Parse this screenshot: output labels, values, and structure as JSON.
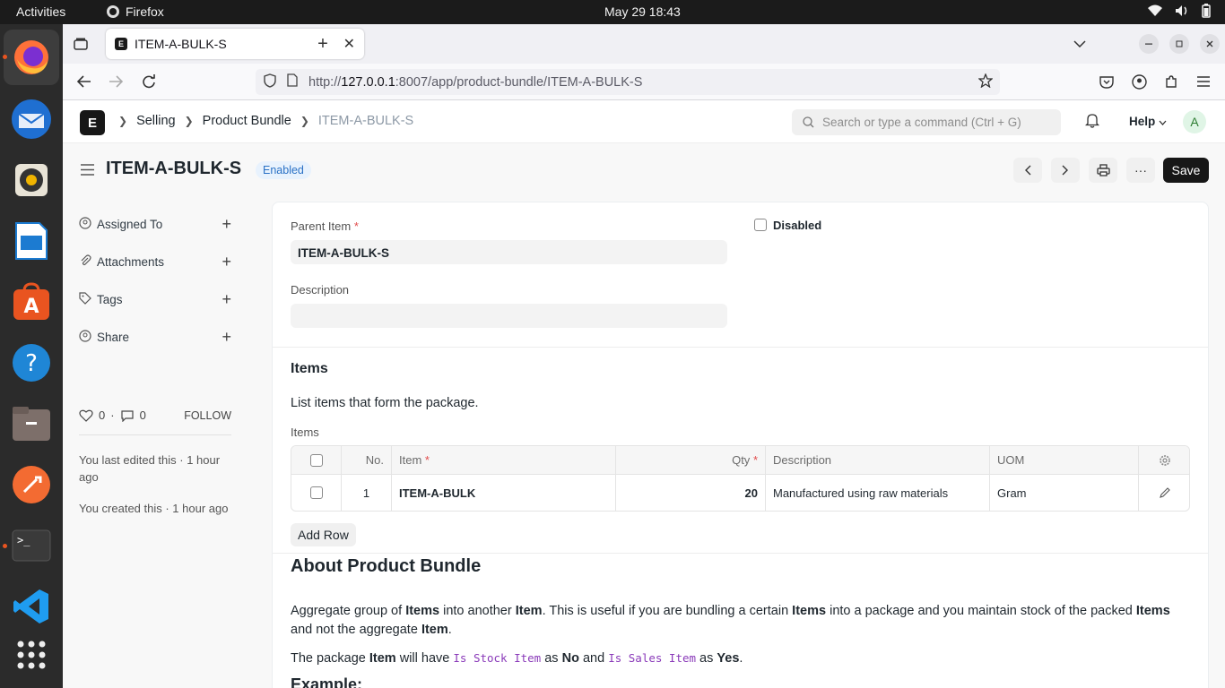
{
  "topbar": {
    "activities": "Activities",
    "app_name": "Firefox",
    "clock": "May 29  18:43"
  },
  "browser": {
    "tab_title": "ITEM-A-BULK-S",
    "url_prefix": "http://",
    "url_host": "127.0.0.1",
    "url_rest": ":8007/app/product-bundle/ITEM-A-BULK-S"
  },
  "app": {
    "logo": "E",
    "breadcrumbs": [
      "Selling",
      "Product Bundle",
      "ITEM-A-BULK-S"
    ],
    "search_placeholder": "Search or type a command (Ctrl + G)",
    "help_label": "Help",
    "avatar_initial": "A"
  },
  "doc": {
    "title": "ITEM-A-BULK-S",
    "status": "Enabled",
    "save_label": "Save"
  },
  "sidebar": {
    "items": [
      {
        "label": "Assigned To"
      },
      {
        "label": "Attachments"
      },
      {
        "label": "Tags"
      },
      {
        "label": "Share"
      }
    ],
    "likes": "0",
    "comments": "0",
    "follow_label": "FOLLOW",
    "last_edited": "You last edited this · 1 hour ago",
    "created": "You created this · 1 hour ago"
  },
  "form": {
    "parent_item_label": "Parent Item",
    "parent_item_value": "ITEM-A-BULK-S",
    "disabled_label": "Disabled",
    "description_label": "Description",
    "description_value": "",
    "items_section_title": "Items",
    "items_help": "List items that form the package.",
    "items_table_label": "Items",
    "columns": {
      "no": "No.",
      "item": "Item",
      "qty": "Qty",
      "description": "Description",
      "uom": "UOM"
    },
    "rows": [
      {
        "no": "1",
        "item": "ITEM-A-BULK",
        "qty": "20",
        "description": "Manufactured using raw materials",
        "uom": "Gram"
      }
    ],
    "add_row_label": "Add Row"
  },
  "about": {
    "title": "About Product Bundle",
    "p1_a": "Aggregate group of ",
    "p1_b": "Items",
    "p1_c": " into another ",
    "p1_d": "Item",
    "p1_e": ". This is useful if you are bundling a certain ",
    "p1_f": "Items",
    "p1_g": " into a package and you maintain stock of the packed ",
    "p1_h": "Items",
    "p1_i": " and not the aggregate ",
    "p1_j": "Item",
    "p1_k": ".",
    "p2_a": "The package ",
    "p2_b": "Item",
    "p2_c": " will have ",
    "p2_d": "Is Stock Item",
    "p2_e": " as ",
    "p2_f": "No",
    "p2_g": " and ",
    "p2_h": "Is Sales Item",
    "p2_i": " as ",
    "p2_j": "Yes",
    "p2_k": ".",
    "example_heading": "Example:"
  }
}
